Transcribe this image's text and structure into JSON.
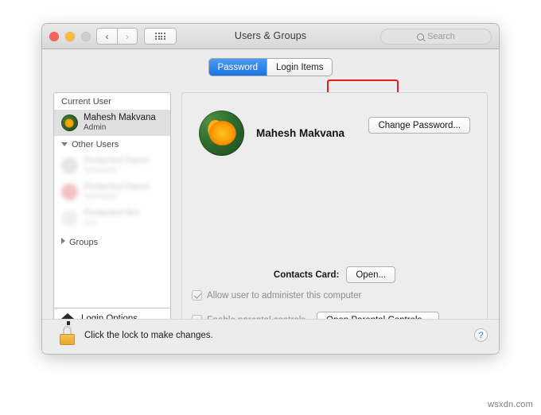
{
  "window": {
    "title": "Users & Groups",
    "traffic_lights": [
      "close",
      "minimize",
      "zoom"
    ],
    "nav_back": "‹",
    "nav_forward": "›",
    "grid_button": "show-all",
    "search": {
      "placeholder": "Search",
      "value": ""
    }
  },
  "tabs": [
    {
      "label": "Password",
      "active": true
    },
    {
      "label": "Login Items",
      "active": false
    }
  ],
  "annotation": {
    "color": "#ee1b1b",
    "target": "Login Items"
  },
  "sidebar": {
    "groups": [
      {
        "label": "Current User",
        "disclosure": "none"
      },
      {
        "label": "Other Users",
        "disclosure": "open"
      },
      {
        "label": "Groups",
        "disclosure": "closed"
      }
    ],
    "current_user": {
      "name": "Mahesh Makvana",
      "role": "Admin",
      "selected": true
    },
    "other_users": [
      {
        "name": "",
        "role": "",
        "redacted": true
      },
      {
        "name": "",
        "role": "",
        "redacted": true
      },
      {
        "name": "",
        "role": "",
        "redacted": true
      }
    ],
    "login_options": {
      "label": "Login Options",
      "icon": "house-icon"
    },
    "add_label": "+",
    "remove_label": "−"
  },
  "main": {
    "user_fullname": "Mahesh Makvana",
    "avatar": "flower-poppy-avatar",
    "change_password_label": "Change Password...",
    "contacts_card_label": "Contacts Card:",
    "contacts_open_label": "Open...",
    "admin_checkbox": {
      "label": "Allow user to administer this computer",
      "checked": true,
      "enabled": false
    },
    "parental_checkbox": {
      "label": "Enable parental controls",
      "checked": false,
      "enabled": false
    },
    "parental_button_label": "Open Parental Controls..."
  },
  "lockbar": {
    "text": "Click the lock to make changes.",
    "lock_state": "locked",
    "help_label": "?"
  },
  "watermark": "wsxdn.com"
}
